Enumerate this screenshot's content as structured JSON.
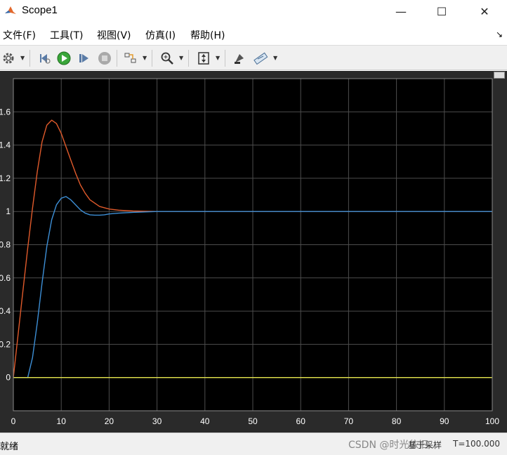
{
  "window": {
    "title": "Scope1",
    "minimize_glyph": "—",
    "maximize_glyph": "☐",
    "close_glyph": "✕"
  },
  "menu": {
    "items": [
      "文件(F)",
      "工具(T)",
      "视图(V)",
      "仿真(I)",
      "帮助(H)"
    ],
    "corner_glyph": "↘"
  },
  "toolbar": {
    "icons": [
      "gear-icon",
      "step-back-icon",
      "run-icon",
      "step-forward-icon",
      "stop-icon",
      "highlight-block-icon",
      "zoom-icon",
      "autoscale-icon",
      "style-icon",
      "measure-icon"
    ]
  },
  "status": {
    "state": "就绪",
    "watermark": "CSDN @时光依旧...",
    "sample_mode": "基于采样",
    "time": "T=100.000"
  },
  "colors": {
    "plot_bg": "#000000",
    "frame_bg": "#2a2a2a",
    "grid": "#4d4d4d",
    "axis_text": "#ffffff",
    "series_orange": "#e05a2b",
    "series_blue": "#3d8fd6",
    "series_yellow": "#e6e64d"
  },
  "chart_data": {
    "type": "line",
    "title": "",
    "xlabel": "",
    "ylabel": "",
    "xlim": [
      0,
      100
    ],
    "ylim": [
      -0.2,
      1.8
    ],
    "xticks": [
      0,
      10,
      20,
      30,
      40,
      50,
      60,
      70,
      80,
      90,
      100
    ],
    "yticks": [
      0,
      0.2,
      0.4,
      0.6,
      0.8,
      1,
      1.2,
      1.4,
      1.6
    ],
    "ytick_labels": [
      "0",
      "0.2",
      "0.4",
      "0.6",
      "0.8",
      "1",
      "1.2",
      "1.4",
      "1.6"
    ],
    "grid": true,
    "series": [
      {
        "color": "#e05a2b",
        "x": [
          0,
          1,
          2,
          3,
          4,
          5,
          6,
          7,
          8,
          9,
          10,
          11,
          12,
          13,
          14,
          15,
          16,
          18,
          20,
          22,
          25,
          30,
          35,
          40,
          50,
          100
        ],
        "y": [
          0,
          0.26,
          0.52,
          0.78,
          1.02,
          1.24,
          1.42,
          1.52,
          1.55,
          1.53,
          1.47,
          1.39,
          1.31,
          1.23,
          1.16,
          1.11,
          1.07,
          1.03,
          1.015,
          1.008,
          1.003,
          1.0,
          1.0,
          1.0,
          1.0,
          1.0
        ]
      },
      {
        "color": "#3d8fd6",
        "x": [
          0,
          3,
          4,
          5,
          6,
          7,
          8,
          9,
          10,
          11,
          12,
          13,
          14,
          15,
          16,
          17,
          18,
          19,
          20,
          22,
          25,
          28,
          30,
          35,
          40,
          50,
          100
        ],
        "y": [
          0,
          0,
          0.12,
          0.33,
          0.57,
          0.79,
          0.95,
          1.04,
          1.08,
          1.09,
          1.07,
          1.04,
          1.01,
          0.99,
          0.98,
          0.978,
          0.978,
          0.98,
          0.985,
          0.99,
          0.995,
          0.998,
          1.0,
          1.0,
          1.0,
          1.0,
          1.0
        ]
      },
      {
        "color": "#e6e64d",
        "x": [
          0,
          100
        ],
        "y": [
          0,
          0
        ]
      }
    ]
  }
}
